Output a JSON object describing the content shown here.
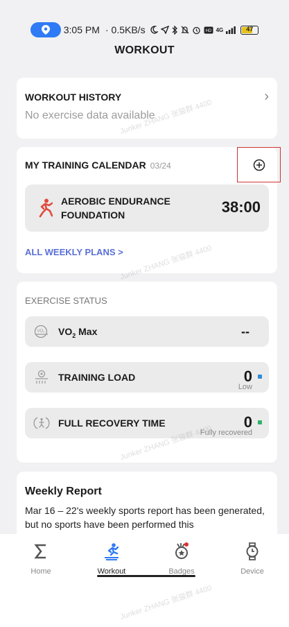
{
  "status_bar": {
    "time": "3:05 PM",
    "separator": "·",
    "speed": "0.5KB/s",
    "network": "4G",
    "battery": "47"
  },
  "page_title": "WORKOUT",
  "history": {
    "title": "WORKOUT HISTORY",
    "subtitle": "No exercise data available",
    "chevron": "›"
  },
  "calendar": {
    "title": "MY TRAINING CALENDAR",
    "date": "03/24",
    "plan": {
      "name": "AEROBIC ENDURANCE FOUNDATION",
      "time": "38:00",
      "icon": "runner-icon"
    },
    "all_plans_label": "ALL WEEKLY PLANS >"
  },
  "exercise_status": {
    "title": "EXERCISE STATUS",
    "rows": [
      {
        "label_main": "VO",
        "label_sub": "2",
        "label_tail": " Max",
        "value": "--",
        "sub": "",
        "icon": "vo2-icon"
      },
      {
        "label_main": "TRAINING LOAD",
        "label_sub": "",
        "label_tail": "",
        "value": "0",
        "sub": "Low",
        "icon": "training-load-icon",
        "dot_color": "#2f8bd8"
      },
      {
        "label_main": "FULL RECOVERY TIME",
        "label_sub": "",
        "label_tail": "",
        "value": "0",
        "sub": "Fully recovered",
        "icon": "recovery-icon",
        "dot_color": "#2fb36a"
      }
    ]
  },
  "report": {
    "title": "Weekly Report",
    "body": "Mar 16 – 22's weekly sports report has been generated, but no sports have been performed this"
  },
  "nav": {
    "items": [
      {
        "label": "Home",
        "icon": "sigma-icon"
      },
      {
        "label": "Workout",
        "icon": "workout-icon"
      },
      {
        "label": "Badges",
        "icon": "badge-icon"
      },
      {
        "label": "Device",
        "icon": "watch-icon"
      }
    ]
  },
  "colors": {
    "accent_blue": "#2f7bf5",
    "runner_red": "#e04a3c",
    "highlight_box": "#d43030",
    "link_gradient": "#5a6fd6"
  },
  "watermark": "Junker ZHANG 张骏群 4400"
}
